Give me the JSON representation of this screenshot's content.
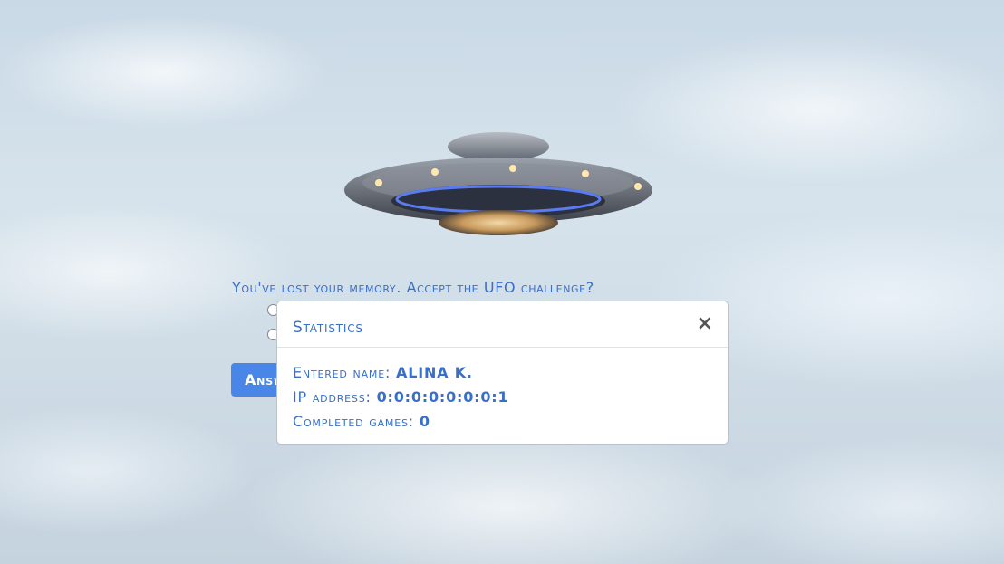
{
  "question": {
    "text": "You've lost your memory. Accept the UFO challenge?"
  },
  "answer_button": {
    "label": "Answer"
  },
  "modal": {
    "title": "Statistics",
    "close_symbol": "×",
    "stats": [
      {
        "label": "Entered name:",
        "value": "ALINA K."
      },
      {
        "label": "IP address:",
        "value": "0:0:0:0:0:0:0:1"
      },
      {
        "label": "Completed games:",
        "value": "0"
      }
    ]
  },
  "colors": {
    "accent": "#3a6fc9",
    "button": "#4a86e8"
  },
  "icons": {
    "ufo": "ufo-image",
    "close": "close-icon"
  }
}
